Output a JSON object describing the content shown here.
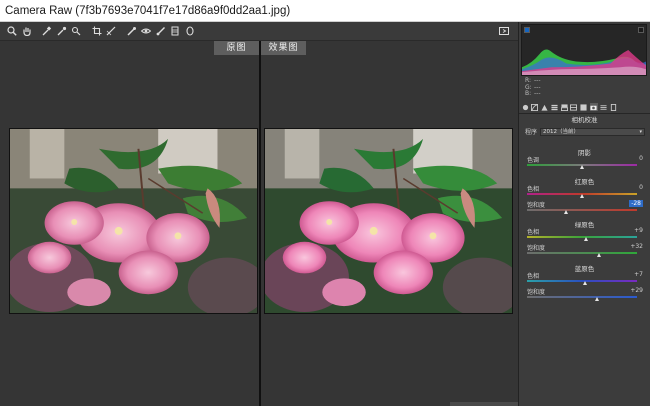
{
  "window": {
    "title": "Camera Raw (7f3b7693e7041f7e17d86a9f0dd2aa1.jpg)"
  },
  "toolbar": {
    "tools": [
      "zoom-icon",
      "hand-icon",
      "white-balance-icon",
      "color-sampler-icon",
      "targeted-adjustment-icon",
      "crop-icon",
      "straighten-icon",
      "spot-removal-icon",
      "red-eye-icon",
      "adjustment-brush-icon",
      "graduated-filter-icon",
      "radial-filter-icon",
      "open-preferences-icon"
    ]
  },
  "preview": {
    "before_label": "原图",
    "after_label": "效果图"
  },
  "histogram": {
    "r_label": "R:",
    "g_label": "G:",
    "b_label": "B:",
    "r_value": "---",
    "g_value": "---",
    "b_value": "---"
  },
  "panel": {
    "title": "相机校准",
    "process_label": "程序",
    "process_value": "2012（当前）",
    "tabs": [
      "basic-icon",
      "tone-curve-icon",
      "detail-icon",
      "hsl-icon",
      "split-toning-icon",
      "lens-icon",
      "effects-icon",
      "camera-calibration-icon",
      "presets-icon",
      "snapshots-icon"
    ]
  },
  "sections": [
    {
      "name": "阴影",
      "sliders": [
        {
          "label": "色调",
          "value": "0",
          "level": 0.5,
          "highlight": false,
          "track": "linear-gradient(90deg,#2e9d3a,#7a7a7a,#9c2aa5)"
        }
      ]
    },
    {
      "name": "红原色",
      "sliders": [
        {
          "label": "色相",
          "value": "0",
          "level": 0.5,
          "highlight": false,
          "track": "linear-gradient(90deg,#b0208a,#c0392b,#c9a227)"
        },
        {
          "label": "饱和度",
          "value": "-28",
          "level": 0.36,
          "highlight": true,
          "track": "linear-gradient(90deg,#6d6d6d,#c0392b)"
        }
      ]
    },
    {
      "name": "绿原色",
      "sliders": [
        {
          "label": "色相",
          "value": "+9",
          "level": 0.545,
          "highlight": false,
          "track": "linear-gradient(90deg,#b5b22a,#3aa33a,#2aa39a)"
        },
        {
          "label": "饱和度",
          "value": "+32",
          "level": 0.66,
          "highlight": false,
          "track": "linear-gradient(90deg,#6d6d6d,#2fa83a)"
        }
      ]
    },
    {
      "name": "蓝原色",
      "sliders": [
        {
          "label": "色相",
          "value": "+7",
          "level": 0.535,
          "highlight": false,
          "track": "linear-gradient(90deg,#2aa0a8,#2a4fc0,#7a2ac0)"
        },
        {
          "label": "饱和度",
          "value": "+29",
          "level": 0.645,
          "highlight": false,
          "track": "linear-gradient(90deg,#6d6d6d,#2a5ad0)"
        }
      ]
    }
  ]
}
